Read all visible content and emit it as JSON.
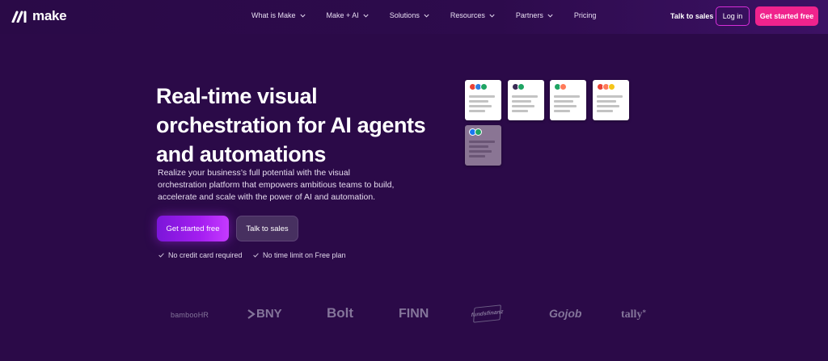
{
  "brand": {
    "name": "make"
  },
  "nav": {
    "items": [
      {
        "label": "What is Make",
        "dropdown": true
      },
      {
        "label": "Make + AI",
        "dropdown": true
      },
      {
        "label": "Solutions",
        "dropdown": true
      },
      {
        "label": "Resources",
        "dropdown": true
      },
      {
        "label": "Partners",
        "dropdown": true
      },
      {
        "label": "Pricing",
        "dropdown": false
      }
    ],
    "talk_to_sales": "Talk to sales",
    "login": "Log in",
    "get_started": "Get started free"
  },
  "hero": {
    "title": "Real-time visual orchestration for AI agents and automations",
    "subtitle": "Realize your business’s full potential with the visual orchestration platform that empowers ambitious teams to build, accelerate and scale with the power of AI and automation.",
    "primary_cta": "Get started free",
    "secondary_cta": "Talk to sales",
    "checks": [
      "No credit card required",
      "No time limit on Free plan"
    ]
  },
  "scenario_cards": [
    {
      "apps": [
        "gmail-icon",
        "workday-icon",
        "sheets-icon"
      ],
      "dim": false
    },
    {
      "apps": [
        "openai-icon",
        "sheets-icon"
      ],
      "dim": false
    },
    {
      "apps": [
        "sheets-icon",
        "hubspot-icon"
      ],
      "dim": false
    },
    {
      "apps": [
        "gmail-icon",
        "hubspot-icon",
        "zoho-icon"
      ],
      "dim": false
    },
    {
      "apps": [
        "facebook-icon",
        "sheets-icon"
      ],
      "dim": true
    }
  ],
  "customer_logos": [
    "bambooHR",
    "BNY",
    "Bolt",
    "FINN",
    "fundsfinanz",
    "Gojob",
    "tally"
  ],
  "colors": {
    "background": "#2b0a48",
    "accent_pink": "#f0238d",
    "accent_purple": "#a41ef0",
    "login_border": "#d62ed8"
  }
}
